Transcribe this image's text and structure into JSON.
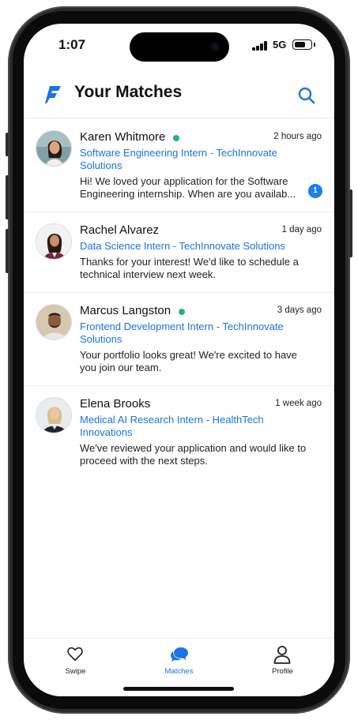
{
  "status_bar": {
    "time": "1:07",
    "network": "5G",
    "battery_level": 0.72
  },
  "header": {
    "title": "Your Matches",
    "logo_icon": "f-logo-icon",
    "search_icon": "search-icon"
  },
  "colors": {
    "accent": "#1a73e8",
    "online": "#22b573",
    "badge": "#1a7ff0"
  },
  "matches": [
    {
      "name": "Karen Whitmore",
      "online": true,
      "time": "2 hours ago",
      "role_lines": [
        "Software Engineering Intern - TechInnovate",
        "Solutions"
      ],
      "message_lines": [
        "Hi! We loved your application for the Software",
        "Engineering internship. When are you availab..."
      ],
      "unread": "1"
    },
    {
      "name": "Rachel Alvarez",
      "online": false,
      "time": "1 day ago",
      "role_lines": [
        "Data Science Intern - TechInnovate Solutions"
      ],
      "message_lines": [
        "Thanks for your interest! We'd like to schedule a",
        "technical interview next week."
      ],
      "unread": null
    },
    {
      "name": "Marcus Langston",
      "online": true,
      "time": "3 days ago",
      "role_lines": [
        "Frontend Development Intern - TechInnovate",
        "Solutions"
      ],
      "message_lines": [
        "Your portfolio looks great! We're excited to have",
        "you join our team."
      ],
      "unread": null
    },
    {
      "name": "Elena Brooks",
      "online": false,
      "time": "1 week ago",
      "role_lines": [
        "Medical AI Research Intern - HealthTech",
        "Innovations"
      ],
      "message_lines": [
        "We've reviewed your application and would like to",
        "proceed with the next steps."
      ],
      "unread": null
    }
  ],
  "tabs": [
    {
      "label": "Swipe",
      "icon": "heart-icon",
      "active": false
    },
    {
      "label": "Matches",
      "icon": "chat-bubbles-icon",
      "active": true
    },
    {
      "label": "Profile",
      "icon": "person-icon",
      "active": false
    }
  ]
}
